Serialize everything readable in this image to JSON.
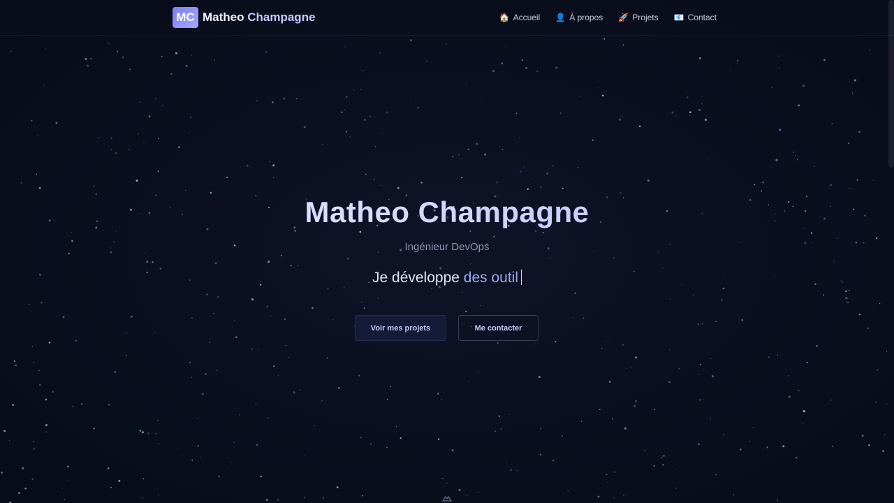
{
  "brand": {
    "logo_text": "MC",
    "name_first": "Matheo",
    "name_last": "Champagne"
  },
  "nav": {
    "items": [
      {
        "icon": "home-icon",
        "glyph": "🏠",
        "label": "Accueil"
      },
      {
        "icon": "user-icon",
        "glyph": "👤",
        "label": "À propos"
      },
      {
        "icon": "rocket-icon",
        "glyph": "🚀",
        "label": "Projets"
      },
      {
        "icon": "mail-icon",
        "glyph": "📧",
        "label": "Contact"
      }
    ]
  },
  "hero": {
    "title": "Matheo Champagne",
    "subtitle": "Ingénieur DevOps",
    "typing_prefix": "Je développe",
    "typing_text": "des outil",
    "primary_button": "Voir mes projets",
    "secondary_button": "Me contacter"
  },
  "colors": {
    "background": "#0a0f1f",
    "accent": "#7b7ff0",
    "typed_text": "#9ea7ee"
  }
}
